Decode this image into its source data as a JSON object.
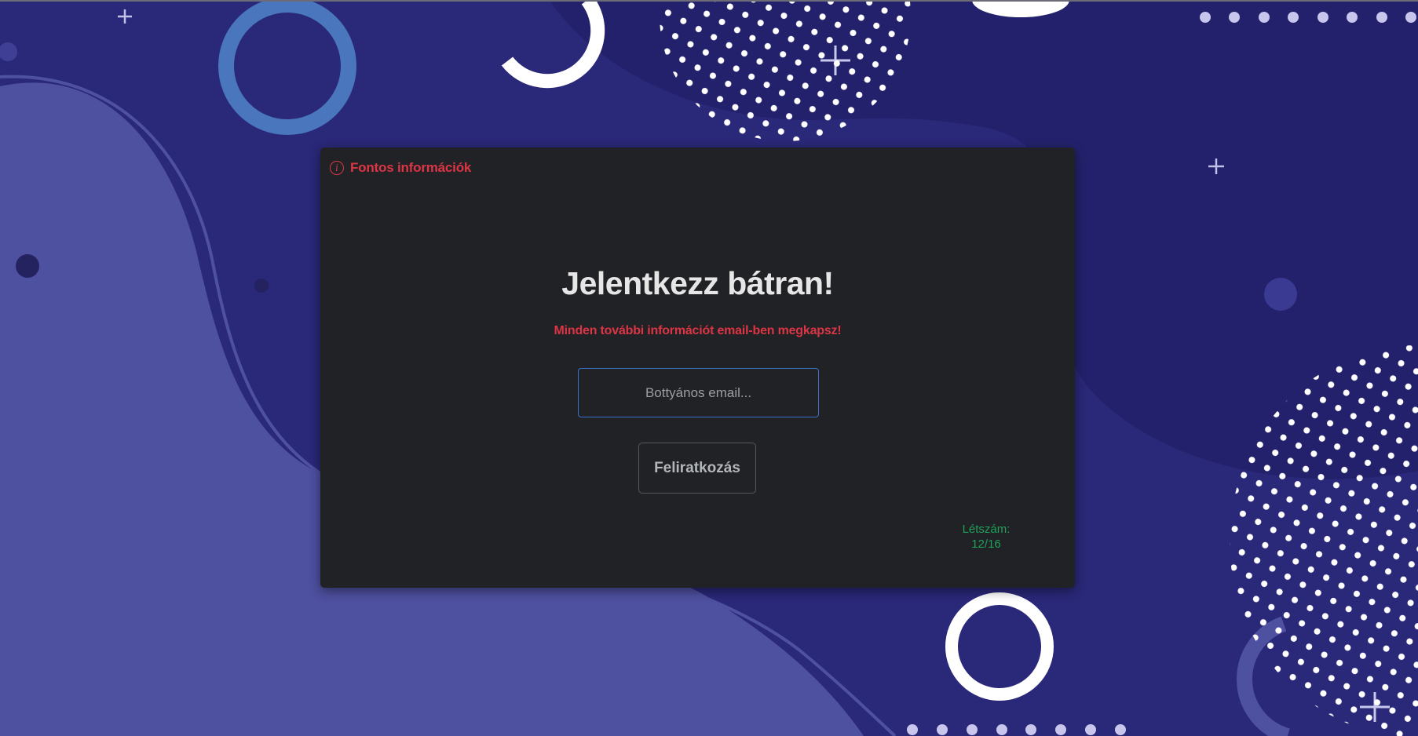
{
  "colors": {
    "background": "#2a2878",
    "card": "#212225",
    "accent_red": "#dc3545",
    "accent_green": "#1fa05a",
    "input_border": "#3b72c9"
  },
  "card": {
    "info_link": {
      "icon": "info-circle-icon",
      "label": "Fontos információk"
    },
    "title": "Jelentkezz bátran!",
    "subtitle": "Minden további információt email-ben megkapsz!",
    "email_input": {
      "value": "",
      "placeholder": "Bottyános email..."
    },
    "subscribe_button": {
      "label": "Feliratkozás"
    },
    "capacity": {
      "label": "Létszám:",
      "value": "12/16"
    }
  }
}
